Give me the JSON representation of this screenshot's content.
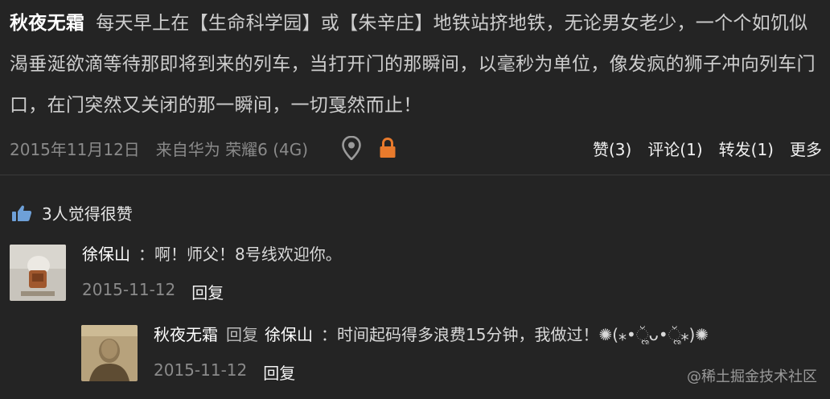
{
  "post": {
    "author": "秋夜无霜",
    "text": "每天早上在【生命科学园】或【朱辛庄】地铁站挤地铁，无论男女老少，一个个如饥似渴垂涎欲滴等待那即将到来的列车，当打开门的那瞬间，以毫秒为单位，像发疯的狮子冲向列车门口，在门突然又关闭的那一瞬间，一切戛然而止！",
    "date": "2015年11月12日",
    "source": "来自华为 荣耀6 (4G)",
    "actions": {
      "like": "赞(3)",
      "comment": "评论(1)",
      "forward": "转发(1)",
      "more": "更多"
    }
  },
  "likes_text": "3人觉得很赞",
  "comments": [
    {
      "author": "徐保山",
      "text": "：啊！师父！8号线欢迎你。",
      "date": "2015-11-12",
      "reply_label": "回复"
    },
    {
      "author": "秋夜无霜",
      "reply_word": "回复",
      "target": "徐保山",
      "text": "：时间起码得多浪费15分钟，我做过！✺(⁎•ૢ̆ᴗ•ૢ̆⁎)✺",
      "date": "2015-11-12",
      "reply_label": "回复"
    }
  ],
  "watermark": "@稀土掘金技术社区",
  "colors": {
    "background": "#242424",
    "lock": "#e87a2c",
    "muted": "#8a8a8a"
  }
}
